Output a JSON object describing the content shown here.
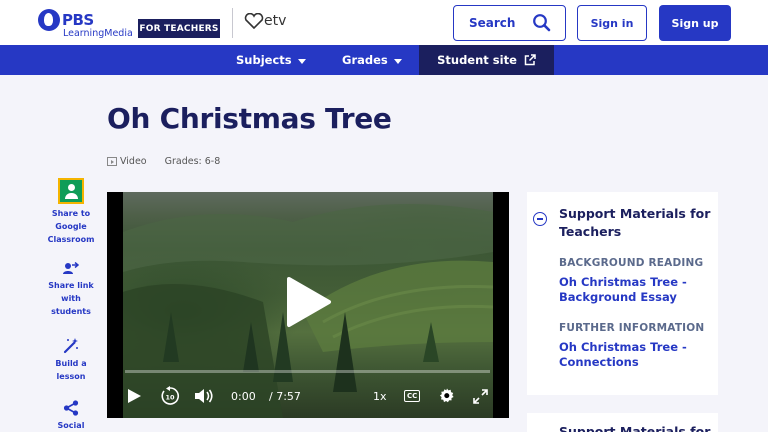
{
  "header": {
    "logo_primary": "PBS",
    "logo_secondary": "LearningMedia",
    "badge": "FOR TEACHERS",
    "partner_logo": "etv",
    "search_label": "Search",
    "signin_label": "Sign in",
    "signup_label": "Sign up"
  },
  "nav": {
    "subjects": "Subjects",
    "grades": "Grades",
    "student_site": "Student site"
  },
  "page": {
    "title": "Oh Christmas Tree",
    "media_type": "Video",
    "grades": "Grades: 6-8"
  },
  "share": {
    "classroom": "Share to Google Classroom",
    "link": "Share link with students",
    "lesson": "Build a lesson",
    "social": "Social"
  },
  "video": {
    "current_time": "0:00",
    "duration": "/ 7:57",
    "speed": "1x",
    "cc": "CC",
    "played_fraction": 0
  },
  "support": {
    "title": "Support Materials for Teachers",
    "sections": [
      {
        "label": "BACKGROUND READING",
        "link": "Oh Christmas Tree - Background Essay"
      },
      {
        "label": "FURTHER INFORMATION",
        "link": "Oh Christmas Tree - Connections"
      }
    ],
    "next_card_title": "Support Materials for"
  },
  "colors": {
    "brand_blue": "#2638c4",
    "navy": "#1b1f5e",
    "page_bg": "#f4f4fa"
  }
}
